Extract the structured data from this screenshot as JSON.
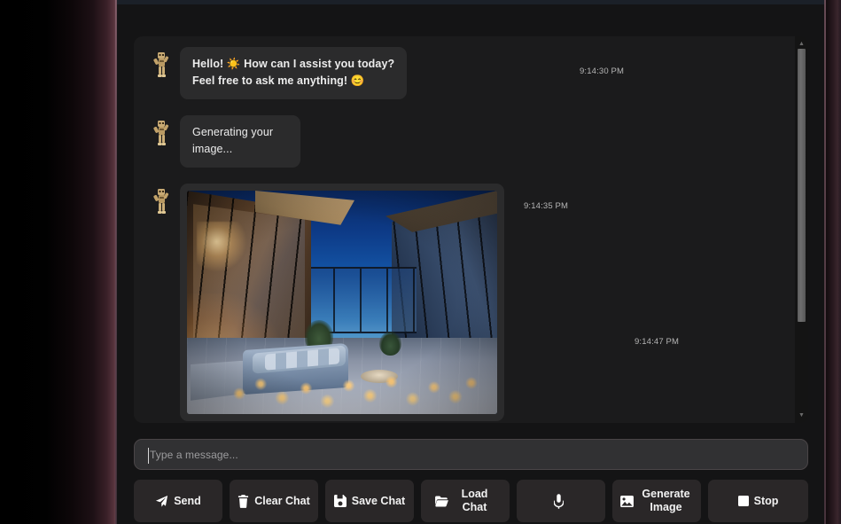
{
  "window": {
    "app_background": "#141415",
    "panel_background": "#1b1b1c",
    "bubble_background": "#2b2b2c",
    "button_background": "#2a2728",
    "text_color": "#ececec",
    "timestamp_color": "#b5b5b5",
    "edge_accent": "#6b4350"
  },
  "chat": {
    "messages": [
      {
        "avatar": "robot-avatar-icon",
        "sender": "assistant",
        "line1": "Hello! ☀️ How can I assist you today?",
        "line1_text": "Hello!",
        "line1_emoji": "☀️",
        "line1_rest": "How can I assist you today?",
        "line2_text": "Feel free to ask me anything!",
        "line2_emoji": "😊",
        "timestamp": "9:14:30 PM"
      },
      {
        "avatar": "robot-avatar-icon",
        "sender": "assistant",
        "text": "Generating your image...",
        "timestamp": "9:14:35 PM"
      },
      {
        "avatar": "robot-avatar-icon",
        "sender": "assistant",
        "type": "image",
        "image_alt": "Luxury penthouse terrace at dusk overlooking the ocean with candles and a sectional sofa",
        "timestamp": "9:14:47 PM"
      }
    ]
  },
  "composer": {
    "input_value": "",
    "placeholder": "Type a message...",
    "buttons": [
      {
        "id": "send",
        "label": "Send",
        "icon": "paper-plane-icon"
      },
      {
        "id": "clear",
        "label": "Clear Chat",
        "icon": "trash-icon"
      },
      {
        "id": "save",
        "label": "Save Chat",
        "icon": "floppy-disk-icon"
      },
      {
        "id": "load",
        "label": "Load Chat",
        "icon": "folder-open-icon"
      },
      {
        "id": "mic",
        "label": "",
        "icon": "microphone-icon"
      },
      {
        "id": "generate",
        "label": "Generate Image",
        "icon": "image-icon"
      },
      {
        "id": "stop",
        "label": "Stop",
        "icon": "stop-square-icon"
      }
    ]
  },
  "scrollbar": {
    "up_arrow": "▲",
    "down_arrow": "▼",
    "thumb_position_percent": 0,
    "thumb_size_percent": 71
  }
}
